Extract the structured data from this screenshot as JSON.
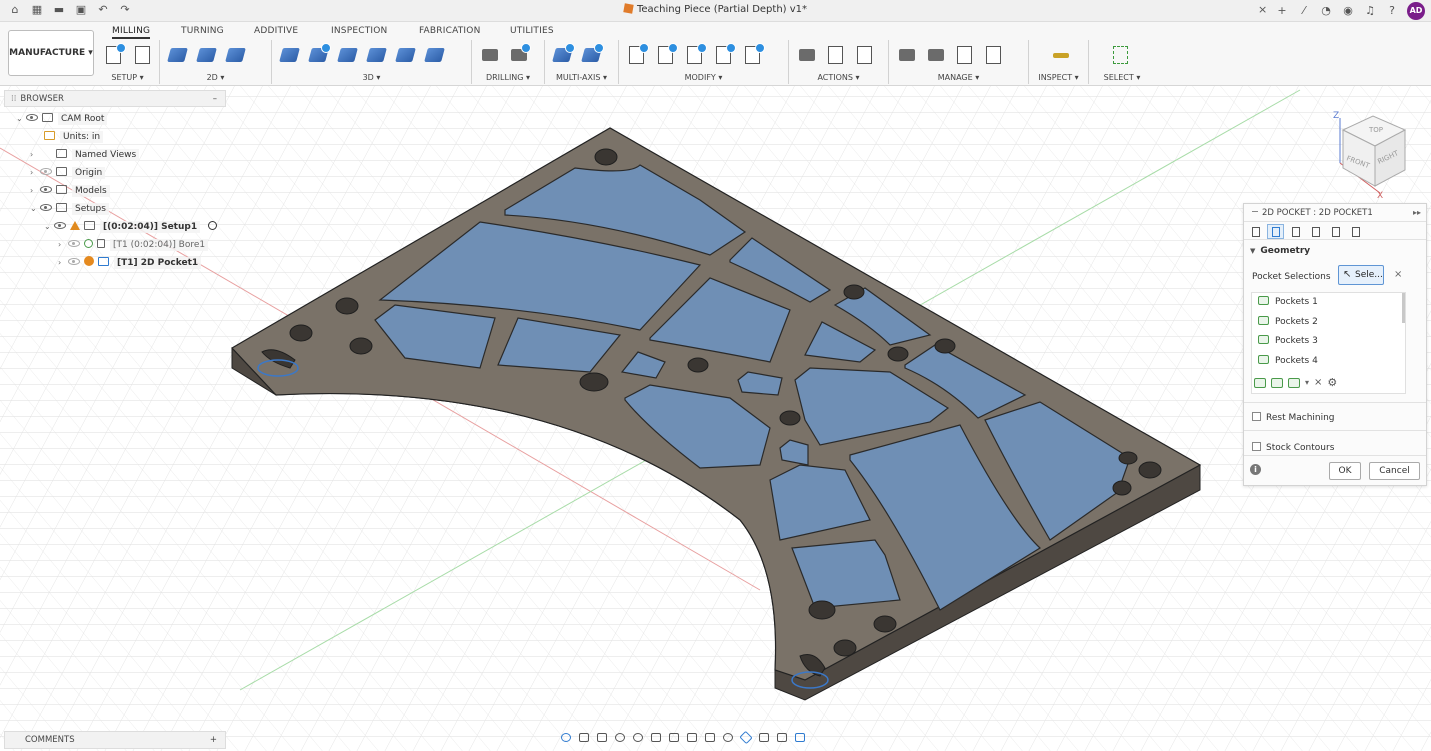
{
  "titlebar": {
    "doc_title": "Teaching Piece (Partial Depth) v1*",
    "close_glyph": "×",
    "user_initials": "AD",
    "left_icons": [
      "home-icon",
      "grid-icon",
      "file-icon",
      "save-icon",
      "undo-icon",
      "redo-icon"
    ],
    "right_icons": [
      "new-tab-icon",
      "extensions-icon",
      "job-status-icon",
      "online-status-icon",
      "notifications-icon",
      "help-icon"
    ]
  },
  "ribbon": {
    "workspace": "MANUFACTURE",
    "tabs": [
      "MILLING",
      "TURNING",
      "ADDITIVE",
      "INSPECTION",
      "FABRICATION",
      "UTILITIES"
    ],
    "active_tab": "MILLING",
    "groups": [
      "SETUP ▾",
      "2D ▾",
      "3D ▾",
      "DRILLING ▾",
      "MULTI-AXIS ▾",
      "MODIFY ▾",
      "ACTIONS ▾",
      "MANAGE ▾",
      "INSPECT ▾",
      "SELECT ▾"
    ]
  },
  "browser": {
    "title": "BROWSER",
    "collapse": "–",
    "items": [
      {
        "label": "CAM Root"
      },
      {
        "label": "Units: in"
      },
      {
        "label": "Named Views"
      },
      {
        "label": "Origin"
      },
      {
        "label": "Models"
      },
      {
        "label": "Setups"
      },
      {
        "label": "[(0:02:04)] Setup1"
      },
      {
        "label": "[T1 (0:02:04)] Bore1"
      },
      {
        "label": "[T1] 2D Pocket1"
      }
    ]
  },
  "comments": {
    "title": "COMMENTS",
    "add": "+"
  },
  "viewcube": {
    "top": "TOP",
    "front": "FRONT",
    "right": "RIGHT",
    "z": "Z",
    "x": "X"
  },
  "props": {
    "title": "2D POCKET : 2D POCKET1",
    "expand": "▸▸",
    "section": "Geometry",
    "pocket_selections_label": "Pocket Selections",
    "select_button": "Sele...",
    "clear": "×",
    "pockets": [
      "Pockets 1",
      "Pockets 2",
      "Pockets 3",
      "Pockets 4"
    ],
    "rest_machining": "Rest Machining",
    "stock_contours": "Stock Contours",
    "ok": "OK",
    "cancel": "Cancel",
    "info": "i"
  },
  "colors": {
    "accent": "#2f7bd0",
    "part": "#7a7268",
    "pocket": "#6f8fb5",
    "avatar": "#7a1d8a"
  }
}
